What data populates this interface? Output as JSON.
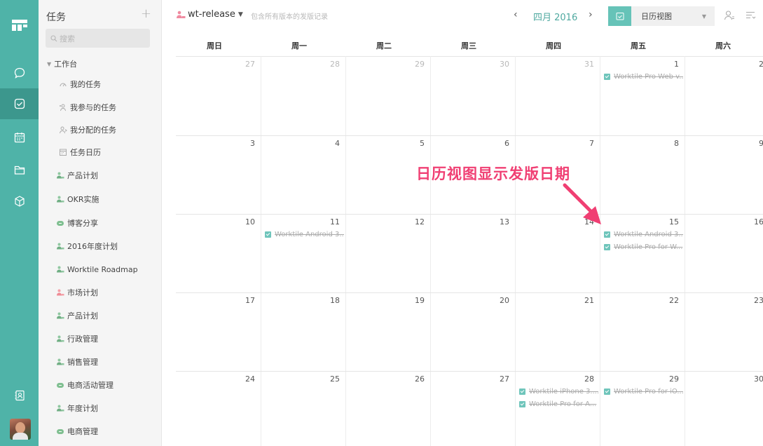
{
  "sidebar": {
    "title": "任务",
    "search_placeholder": "搜索",
    "section": "工作台",
    "items": [
      {
        "label": "我的任务",
        "icon": "gauge-icon"
      },
      {
        "label": "我参与的任务",
        "icon": "participate-icon"
      },
      {
        "label": "我分配的任务",
        "icon": "assign-icon"
      },
      {
        "label": "任务日历",
        "icon": "calendar-icon"
      },
      {
        "label": "产品计划",
        "icon": "project-icon"
      },
      {
        "label": "OKR实施",
        "icon": "project-icon"
      },
      {
        "label": "博客分享",
        "icon": "cloud-icon"
      },
      {
        "label": "2016年度计划",
        "icon": "project-icon"
      },
      {
        "label": "Worktile Roadmap",
        "icon": "project-icon"
      },
      {
        "label": "市场计划",
        "icon": "project-pink-icon"
      },
      {
        "label": "产品计划",
        "icon": "project-icon"
      },
      {
        "label": "行政管理",
        "icon": "project-icon"
      },
      {
        "label": "销售管理",
        "icon": "project-icon"
      },
      {
        "label": "电商活动管理",
        "icon": "cloud-icon"
      },
      {
        "label": "年度计划",
        "icon": "project-icon"
      },
      {
        "label": "电商管理",
        "icon": "cloud-icon"
      }
    ]
  },
  "topbar": {
    "project_name": "wt-release",
    "project_desc": "包含所有版本的发版记录",
    "prev": "‹",
    "next": "›",
    "month_label": "四月 2016",
    "view_label": "日历视图"
  },
  "calendar": {
    "weekdays": [
      "周日",
      "周一",
      "周二",
      "周三",
      "周四",
      "周五",
      "周六"
    ],
    "weeks": [
      [
        {
          "d": "27",
          "m": true
        },
        {
          "d": "28",
          "m": true
        },
        {
          "d": "29",
          "m": true
        },
        {
          "d": "30",
          "m": true
        },
        {
          "d": "31",
          "m": true
        },
        {
          "d": "1",
          "m": false
        },
        {
          "d": "2",
          "m": false
        }
      ],
      [
        {
          "d": "3"
        },
        {
          "d": "4"
        },
        {
          "d": "5"
        },
        {
          "d": "6"
        },
        {
          "d": "7"
        },
        {
          "d": "8"
        },
        {
          "d": "9"
        }
      ],
      [
        {
          "d": "10"
        },
        {
          "d": "11"
        },
        {
          "d": "12"
        },
        {
          "d": "13"
        },
        {
          "d": "14"
        },
        {
          "d": "15"
        },
        {
          "d": "16"
        }
      ],
      [
        {
          "d": "17"
        },
        {
          "d": "18"
        },
        {
          "d": "19"
        },
        {
          "d": "20"
        },
        {
          "d": "21"
        },
        {
          "d": "22"
        },
        {
          "d": "23"
        }
      ],
      [
        {
          "d": "24"
        },
        {
          "d": "25"
        },
        {
          "d": "26"
        },
        {
          "d": "27"
        },
        {
          "d": "28"
        },
        {
          "d": "29"
        },
        {
          "d": "30"
        }
      ]
    ],
    "events": [
      {
        "week": 0,
        "day": 5,
        "slot": 0,
        "text": "Worktile Pro Web v..."
      },
      {
        "week": 2,
        "day": 1,
        "slot": 0,
        "text": "Worktile Android 3..."
      },
      {
        "week": 2,
        "day": 5,
        "slot": 0,
        "text": "Worktile Android 3..."
      },
      {
        "week": 2,
        "day": 5,
        "slot": 1,
        "text": "Worktile Pro for W..."
      },
      {
        "week": 4,
        "day": 4,
        "slot": 0,
        "text": "Worktile iPhone 3...."
      },
      {
        "week": 4,
        "day": 4,
        "slot": 1,
        "text": "Worktile Pro for A..."
      },
      {
        "week": 4,
        "day": 5,
        "slot": 0,
        "text": "Worktile Pro for iO..."
      }
    ]
  },
  "annotation": "日历视图显示发版日期",
  "colors": {
    "rail": "#4fb3a8",
    "rail_active": "#3c978d",
    "accent": "#66c3b8",
    "annotation": "#f03f73"
  }
}
